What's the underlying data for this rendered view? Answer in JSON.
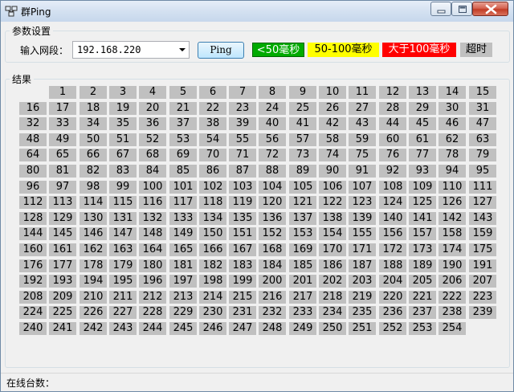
{
  "window": {
    "title": "群Ping",
    "icon": "network-computer-icon",
    "controls": [
      "minimize-icon",
      "maximize-icon",
      "close-icon"
    ]
  },
  "params": {
    "group_title": "参数设置",
    "range_label": "输入网段：",
    "range_value": "192.168.220",
    "ping_label": "Ping",
    "legend": {
      "fast": "<50毫秒",
      "medium": "50-100毫秒",
      "slow": "大于100毫秒",
      "timeout": "超时"
    }
  },
  "colors": {
    "fast": "#00aa00",
    "medium": "#ffff00",
    "slow": "#ff0000",
    "timeout": "#c0c0c0",
    "cell": "#c0c0c0"
  },
  "results": {
    "group_title": "结果",
    "first": 1,
    "last": 254,
    "columns": 16
  },
  "status": {
    "label": "在线台数：",
    "value": ""
  }
}
